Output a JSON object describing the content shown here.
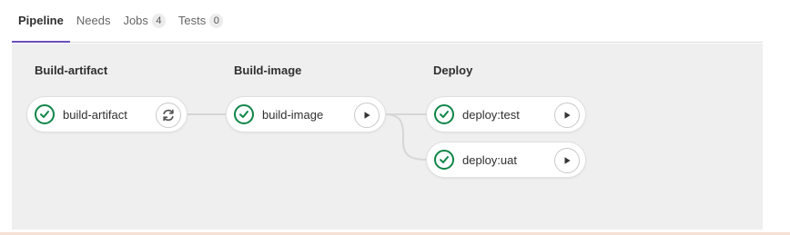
{
  "tabs": [
    {
      "label": "Pipeline",
      "active": true
    },
    {
      "label": "Needs"
    },
    {
      "label": "Jobs",
      "count": "4"
    },
    {
      "label": "Tests",
      "count": "0"
    }
  ],
  "stages": [
    {
      "title": "Build-artifact",
      "jobs": [
        {
          "name": "build-artifact",
          "status": "passed",
          "action": "retry-icon"
        }
      ]
    },
    {
      "title": "Build-image",
      "jobs": [
        {
          "name": "build-image",
          "status": "passed",
          "action": "play-icon"
        }
      ]
    },
    {
      "title": "Deploy",
      "jobs": [
        {
          "name": "deploy:test",
          "status": "passed",
          "action": "play-icon"
        },
        {
          "name": "deploy:uat",
          "status": "passed",
          "action": "play-icon"
        }
      ]
    }
  ],
  "colors": {
    "success": "#108548",
    "active_tab": "#6b4fbb",
    "pipeline_bg": "#efefef"
  }
}
